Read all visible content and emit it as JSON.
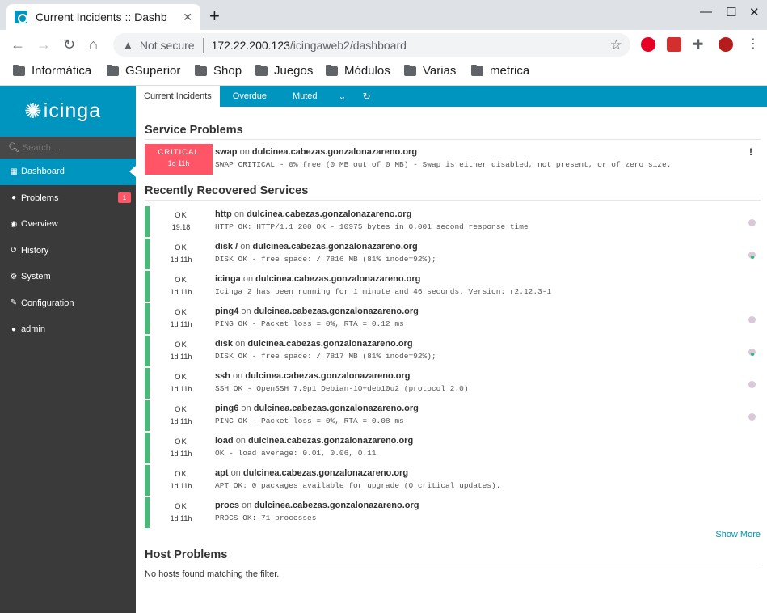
{
  "browser": {
    "tab_title": "Current Incidents :: Dashb",
    "not_secure": "Not secure",
    "url_host": "172.22.200.123",
    "url_path": "/icingaweb2/dashboard",
    "bookmarks": [
      "Informática",
      "GSuperior",
      "Shop",
      "Juegos",
      "Módulos",
      "Varias",
      "metrica"
    ]
  },
  "sidebar": {
    "logo": "icinga",
    "search_placeholder": "Search ...",
    "items": [
      {
        "label": "Dashboard",
        "icon": "dashboard-icon"
      },
      {
        "label": "Problems",
        "icon": "problems-icon",
        "badge": "1"
      },
      {
        "label": "Overview",
        "icon": "overview-icon"
      },
      {
        "label": "History",
        "icon": "history-icon"
      },
      {
        "label": "System",
        "icon": "system-icon"
      },
      {
        "label": "Configuration",
        "icon": "configuration-icon"
      },
      {
        "label": "admin",
        "icon": "user-icon"
      }
    ]
  },
  "tabs": [
    "Current Incidents",
    "Overdue",
    "Muted"
  ],
  "service_problems": {
    "title": "Service Problems",
    "items": [
      {
        "state": "CRITICAL",
        "duration": "1d 11h",
        "service": "swap",
        "on": "on",
        "host": "dulcinea.cabezas.gonzalonazareno.org",
        "output": "SWAP CRITICAL - 0% free (0 MB out of 0 MB) - Swap is either disabled, not present, or of zero size."
      }
    ]
  },
  "recovered": {
    "title": "Recently Recovered Services",
    "items": [
      {
        "state": "OK",
        "duration": "19:18",
        "service": "http",
        "on": "on",
        "host": "dulcinea.cabezas.gonzalonazareno.org",
        "output": "HTTP OK: HTTP/1.1 200 OK - 10975 bytes in 0.001 second response time"
      },
      {
        "state": "OK",
        "duration": "1d 11h",
        "service": "disk /",
        "on": "on",
        "host": "dulcinea.cabezas.gonzalonazareno.org",
        "output": "DISK OK - free space: / 7816 MB (81% inode=92%);"
      },
      {
        "state": "OK",
        "duration": "1d 11h",
        "service": "icinga",
        "on": "on",
        "host": "dulcinea.cabezas.gonzalonazareno.org",
        "output": "Icinga 2 has been running for 1 minute and 46 seconds. Version: r2.12.3-1"
      },
      {
        "state": "OK",
        "duration": "1d 11h",
        "service": "ping4",
        "on": "on",
        "host": "dulcinea.cabezas.gonzalonazareno.org",
        "output": "PING OK - Packet loss = 0%, RTA = 0.12 ms"
      },
      {
        "state": "OK",
        "duration": "1d 11h",
        "service": "disk",
        "on": "on",
        "host": "dulcinea.cabezas.gonzalonazareno.org",
        "output": "DISK OK - free space: / 7817 MB (81% inode=92%);"
      },
      {
        "state": "OK",
        "duration": "1d 11h",
        "service": "ssh",
        "on": "on",
        "host": "dulcinea.cabezas.gonzalonazareno.org",
        "output": "SSH OK - OpenSSH_7.9p1 Debian-10+deb10u2 (protocol 2.0)"
      },
      {
        "state": "OK",
        "duration": "1d 11h",
        "service": "ping6",
        "on": "on",
        "host": "dulcinea.cabezas.gonzalonazareno.org",
        "output": "PING OK - Packet loss = 0%, RTA = 0.08 ms"
      },
      {
        "state": "OK",
        "duration": "1d 11h",
        "service": "load",
        "on": "on",
        "host": "dulcinea.cabezas.gonzalonazareno.org",
        "output": "OK - load average: 0.01, 0.06, 0.11"
      },
      {
        "state": "OK",
        "duration": "1d 11h",
        "service": "apt",
        "on": "on",
        "host": "dulcinea.cabezas.gonzalonazareno.org",
        "output": "APT OK: 0 packages available for upgrade (0 critical updates)."
      },
      {
        "state": "OK",
        "duration": "1d 11h",
        "service": "procs",
        "on": "on",
        "host": "dulcinea.cabezas.gonzalonazareno.org",
        "output": "PROCS OK: 71 processes"
      }
    ],
    "show_more": "Show More"
  },
  "host_problems": {
    "title": "Host Problems",
    "empty": "No hosts found matching the filter."
  }
}
